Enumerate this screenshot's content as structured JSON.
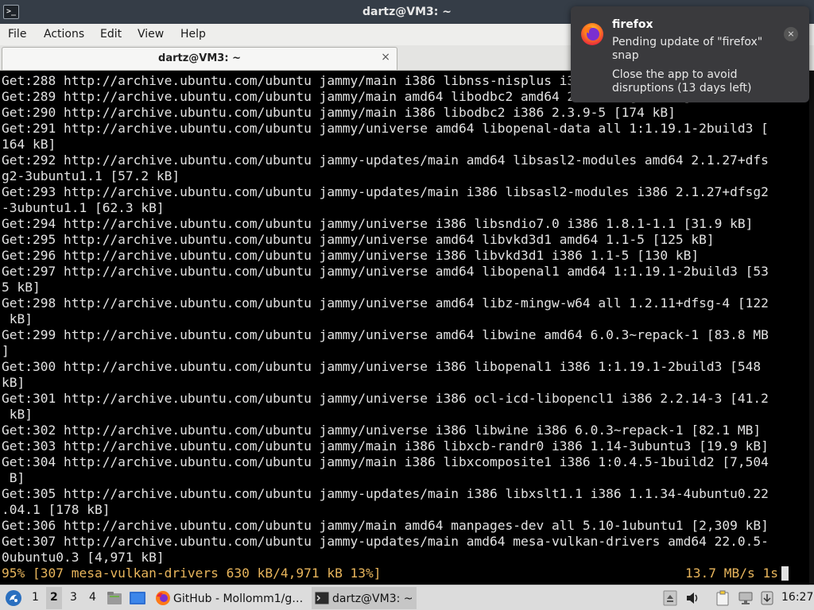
{
  "window": {
    "title": "dartz@VM3: ~"
  },
  "menu": [
    "File",
    "Actions",
    "Edit",
    "View",
    "Help"
  ],
  "tab": {
    "label": "dartz@VM3: ~",
    "close": "×"
  },
  "terminal": {
    "lines": [
      "Get:288 http://archive.ubuntu.com/ubuntu jammy/main i386 libnss-nisplus i386 1.3-4build2 [21.6 kB]",
      "Get:289 http://archive.ubuntu.com/ubuntu jammy/main amd64 libodbc2 amd64 2.3.9-5 [158 kB]",
      "Get:290 http://archive.ubuntu.com/ubuntu jammy/main i386 libodbc2 i386 2.3.9-5 [174 kB]",
      "Get:291 http://archive.ubuntu.com/ubuntu jammy/universe amd64 libopenal-data all 1:1.19.1-2build3 [",
      "164 kB]",
      "Get:292 http://archive.ubuntu.com/ubuntu jammy-updates/main amd64 libsasl2-modules amd64 2.1.27+dfs",
      "g2-3ubuntu1.1 [57.2 kB]",
      "Get:293 http://archive.ubuntu.com/ubuntu jammy-updates/main i386 libsasl2-modules i386 2.1.27+dfsg2",
      "-3ubuntu1.1 [62.3 kB]",
      "Get:294 http://archive.ubuntu.com/ubuntu jammy/universe i386 libsndio7.0 i386 1.8.1-1.1 [31.9 kB]",
      "Get:295 http://archive.ubuntu.com/ubuntu jammy/universe amd64 libvkd3d1 amd64 1.1-5 [125 kB]",
      "Get:296 http://archive.ubuntu.com/ubuntu jammy/universe i386 libvkd3d1 i386 1.1-5 [130 kB]",
      "Get:297 http://archive.ubuntu.com/ubuntu jammy/universe amd64 libopenal1 amd64 1:1.19.1-2build3 [53",
      "5 kB]",
      "Get:298 http://archive.ubuntu.com/ubuntu jammy/universe amd64 libz-mingw-w64 all 1.2.11+dfsg-4 [122",
      " kB]",
      "Get:299 http://archive.ubuntu.com/ubuntu jammy/universe amd64 libwine amd64 6.0.3~repack-1 [83.8 MB",
      "]",
      "Get:300 http://archive.ubuntu.com/ubuntu jammy/universe i386 libopenal1 i386 1:1.19.1-2build3 [548",
      "kB]",
      "Get:301 http://archive.ubuntu.com/ubuntu jammy/universe i386 ocl-icd-libopencl1 i386 2.2.14-3 [41.2",
      " kB]",
      "Get:302 http://archive.ubuntu.com/ubuntu jammy/universe i386 libwine i386 6.0.3~repack-1 [82.1 MB]",
      "Get:303 http://archive.ubuntu.com/ubuntu jammy/main i386 libxcb-randr0 i386 1.14-3ubuntu3 [19.9 kB]",
      "Get:304 http://archive.ubuntu.com/ubuntu jammy/main i386 libxcomposite1 i386 1:0.4.5-1build2 [7,504",
      " B]",
      "Get:305 http://archive.ubuntu.com/ubuntu jammy-updates/main i386 libxslt1.1 i386 1.1.34-4ubuntu0.22",
      ".04.1 [178 kB]",
      "Get:306 http://archive.ubuntu.com/ubuntu jammy/main amd64 manpages-dev all 5.10-1ubuntu1 [2,309 kB]",
      "Get:307 http://archive.ubuntu.com/ubuntu jammy-updates/main amd64 mesa-vulkan-drivers amd64 22.0.5-",
      "0ubuntu0.3 [4,971 kB]"
    ],
    "progress_left": "95% [307 mesa-vulkan-drivers 630 kB/4,971 kB 13%]",
    "progress_right": "13.7 MB/s 1s"
  },
  "notification": {
    "app": "firefox",
    "body1": "Pending update of \"firefox\" snap",
    "body2": "Close the app to avoid disruptions (13 days left)",
    "close": "×"
  },
  "taskbar": {
    "workspaces": [
      "1",
      "2",
      "3",
      "4"
    ],
    "active_workspace": "2",
    "tasks": [
      {
        "label": "GitHub - Mollomm1/g…",
        "icon": "firefox-icon"
      },
      {
        "label": "dartz@VM3: ~",
        "icon": "terminal-icon"
      }
    ],
    "clock": "16:27"
  }
}
